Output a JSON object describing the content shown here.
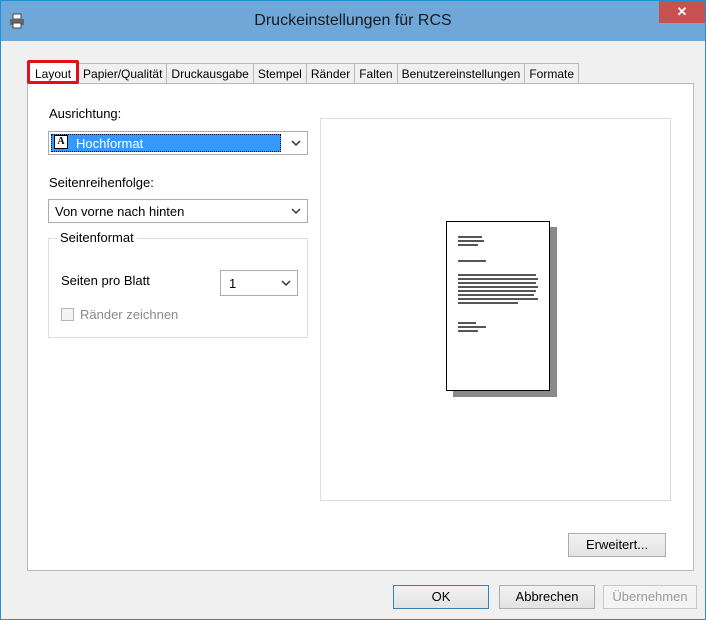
{
  "window": {
    "title": "Druckeinstellungen für RCS",
    "close_label": "✕"
  },
  "tabs": [
    {
      "label": "Layout",
      "active": true
    },
    {
      "label": "Papier/Qualität"
    },
    {
      "label": "Druckausgabe"
    },
    {
      "label": "Stempel"
    },
    {
      "label": "Ränder"
    },
    {
      "label": "Falten"
    },
    {
      "label": "Benutzereinstellungen"
    },
    {
      "label": "Formate"
    }
  ],
  "layout": {
    "orientation_label": "Ausrichtung:",
    "orientation_value": "Hochformat",
    "orientation_icon_letter": "A",
    "page_order_label": "Seitenreihenfolge:",
    "page_order_value": "Von vorne nach hinten",
    "page_format": {
      "legend": "Seitenformat",
      "pages_per_sheet_label": "Seiten pro Blatt",
      "pages_per_sheet_value": "1",
      "draw_borders_label": "Ränder zeichnen",
      "draw_borders_checked": false
    },
    "advanced_button": "Erweitert..."
  },
  "footer": {
    "ok": "OK",
    "cancel": "Abbrechen",
    "apply": "Übernehmen"
  },
  "colors": {
    "titlebar": "#6ea7d8",
    "close_button": "#c75050",
    "selection": "#3399ff",
    "active_tab_highlight": "#e3101a"
  }
}
